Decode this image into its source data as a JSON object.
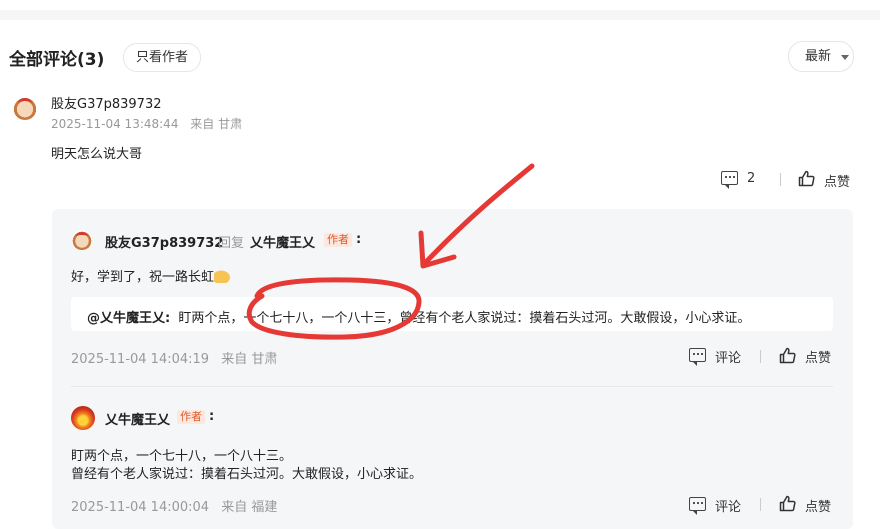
{
  "header": {
    "title": "全部评论(3)",
    "author_only_label": "只看作者",
    "sort_label": "最新"
  },
  "comment": {
    "username": "股友G37p839732",
    "time": "2025-11-04 13:48:44",
    "location": "来自 甘肃",
    "text": "明天怎么说大哥",
    "reply_count": "2",
    "like_label": "点赞"
  },
  "replies": [
    {
      "username": "股友G37p839732",
      "reply_word": "回复",
      "reply_to": "乂牛魔王乂",
      "author_tag": "作者",
      "colon": ":",
      "text": "好，学到了，祝一路长虹",
      "quote_user": "@乂牛魔王乂:",
      "quote_text": "盯两个点，一个七十八，一个八十三，曾经有个老人家说过：摸着石头过河。大敢假设，小心求证。",
      "time": "2025-11-04 14:04:19",
      "location": "来自 甘肃",
      "comment_label": "评论",
      "like_label": "点赞"
    },
    {
      "username": "乂牛魔王乂",
      "author_tag": "作者",
      "colon": ":",
      "text_line1": "盯两个点，一个七十八，一个八十三。",
      "text_line2": "曾经有个老人家说过：摸着石头过河。大敢假设，小心求证。",
      "time": "2025-11-04 14:00:04",
      "location": "来自 福建",
      "comment_label": "评论",
      "like_label": "点赞"
    }
  ],
  "annotation": {
    "color": "#e53935"
  }
}
